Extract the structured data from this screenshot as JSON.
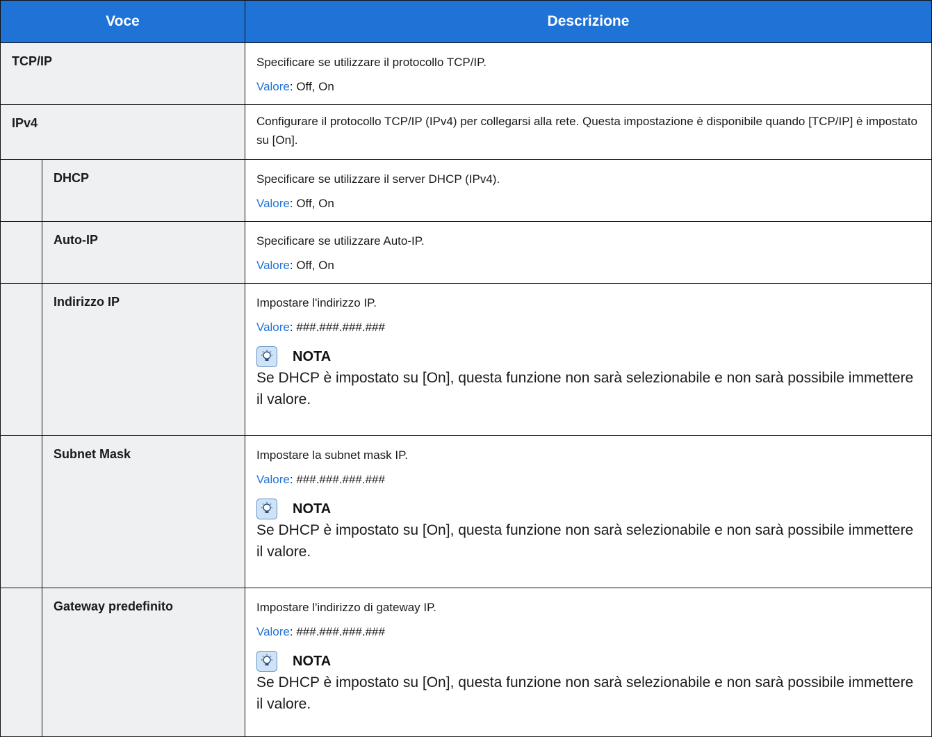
{
  "header": {
    "col_voce": "Voce",
    "col_descrizione": "Descrizione"
  },
  "rows": [
    {
      "name": "TCP/IP",
      "description": "Specificare se utilizzare il protocollo TCP/IP.",
      "value_label": "Valore",
      "value_text": ": Off, On"
    },
    {
      "name": "IPv4",
      "description": "Configurare il protocollo TCP/IP (IPv4) per collegarsi alla rete. Questa impostazione è disponibile quando [TCP/IP] è impostato su [On]."
    },
    {
      "name": "DHCP",
      "description": "Specificare se utilizzare il server DHCP (IPv4).",
      "value_label": "Valore",
      "value_text": ": Off, On"
    },
    {
      "name": "Auto-IP",
      "description": "Specificare se utilizzare Auto-IP.",
      "value_label": "Valore",
      "value_text": ": Off, On"
    },
    {
      "name": "Indirizzo IP",
      "description": "Impostare l'indirizzo IP.",
      "value_label": "Valore",
      "value_text": ": ###.###.###.###",
      "note_title": "NOTA",
      "note_text": "Se DHCP è impostato su [On], questa funzione non sarà selezionabile e non sarà possibile immettere il valore."
    },
    {
      "name": "Subnet Mask",
      "description": "Impostare la subnet mask IP.",
      "value_label": "Valore",
      "value_text": ": ###.###.###.###",
      "note_title": "NOTA",
      "note_text": "Se DHCP è impostato su [On], questa funzione non sarà selezionabile e non sarà possibile immettere il valore."
    },
    {
      "name": "Gateway predefinito",
      "description": "Impostare l'indirizzo di gateway IP.",
      "value_label": "Valore",
      "value_text": ": ###.###.###.###",
      "note_title": "NOTA",
      "note_text": "Se DHCP è impostato su [On], questa funzione non sarà selezionabile e non sarà possibile immettere il valore."
    }
  ],
  "note_icon": "lightbulb-note-icon",
  "colors": {
    "header_bg": "#1f72d6",
    "name_cell_bg": "#eef0f1",
    "value_label": "#1f72d6"
  }
}
